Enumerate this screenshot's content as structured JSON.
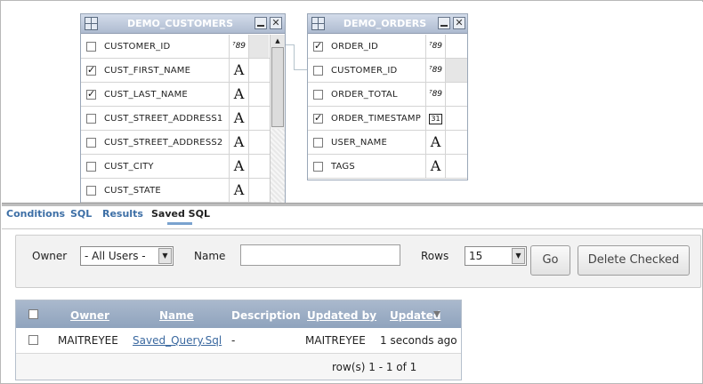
{
  "designer": {
    "customers": {
      "title": "DEMO_CUSTOMERS",
      "columns": [
        {
          "name": "CUSTOMER_ID",
          "checked": false,
          "type": "number",
          "type_glyph": "⁷89"
        },
        {
          "name": "CUST_FIRST_NAME",
          "checked": true,
          "type": "text",
          "type_glyph": "A"
        },
        {
          "name": "CUST_LAST_NAME",
          "checked": true,
          "type": "text",
          "type_glyph": "A"
        },
        {
          "name": "CUST_STREET_ADDRESS1",
          "checked": false,
          "type": "text",
          "type_glyph": "A"
        },
        {
          "name": "CUST_STREET_ADDRESS2",
          "checked": false,
          "type": "text",
          "type_glyph": "A"
        },
        {
          "name": "CUST_CITY",
          "checked": false,
          "type": "text",
          "type_glyph": "A"
        },
        {
          "name": "CUST_STATE",
          "checked": false,
          "type": "text",
          "type_glyph": "A"
        }
      ]
    },
    "orders": {
      "title": "DEMO_ORDERS",
      "columns": [
        {
          "name": "ORDER_ID",
          "checked": true,
          "type": "number",
          "type_glyph": "⁷89"
        },
        {
          "name": "CUSTOMER_ID",
          "checked": false,
          "type": "number",
          "type_glyph": "⁷89"
        },
        {
          "name": "ORDER_TOTAL",
          "checked": false,
          "type": "number",
          "type_glyph": "⁷89"
        },
        {
          "name": "ORDER_TIMESTAMP",
          "checked": true,
          "type": "date",
          "type_glyph": "31"
        },
        {
          "name": "USER_NAME",
          "checked": false,
          "type": "text",
          "type_glyph": "A"
        },
        {
          "name": "TAGS",
          "checked": false,
          "type": "text",
          "type_glyph": "A"
        }
      ]
    },
    "icons": {
      "table": "table-grid-icon",
      "minimize": "minimize-icon",
      "close": "close-icon",
      "close_glyph": "✕"
    }
  },
  "tabs": [
    {
      "label": "Conditions",
      "active": false
    },
    {
      "label": "SQL",
      "active": false
    },
    {
      "label": "Results",
      "active": false
    },
    {
      "label": "Saved SQL",
      "active": true
    }
  ],
  "filter": {
    "owner_label": "Owner",
    "owner_value": "- All Users -",
    "name_label": "Name",
    "name_value": "",
    "rows_label": "Rows",
    "rows_value": "15",
    "go_label": "Go",
    "delete_label": "Delete Checked"
  },
  "report": {
    "headers": {
      "owner": "Owner",
      "name": "Name",
      "description": "Description",
      "updated_by": "Updated by",
      "updated": "Updated"
    },
    "sort": {
      "column": "Updated",
      "direction": "descending"
    },
    "rows": [
      {
        "owner": "MAITREYEE",
        "name": "Saved_Query.Sql",
        "description": "-",
        "updated_by": "MAITREYEE",
        "updated": "1 seconds ago"
      }
    ],
    "pagination": "row(s) 1 - 1 of 1"
  },
  "colors": {
    "tab_link": "#3d6fa6",
    "header_blue": "#8fa3bd",
    "link": "#3b69a0"
  }
}
